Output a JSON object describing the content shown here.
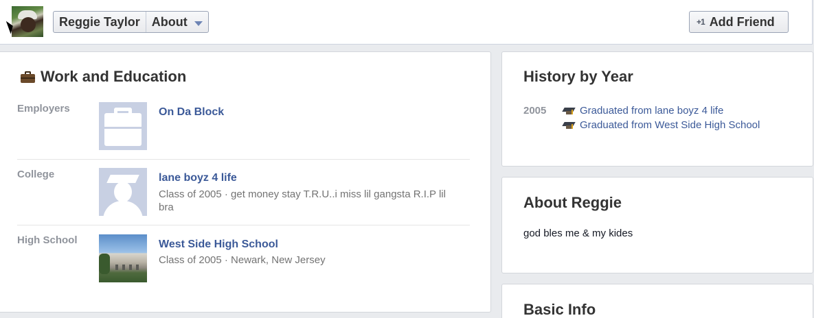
{
  "header": {
    "profile_name": "Reggie Taylor",
    "section": "About",
    "add_friend_label": "Add Friend",
    "add_friend_icon": "+1"
  },
  "work_education": {
    "title": "Work and Education",
    "employers": {
      "label": "Employers",
      "name": "On Da Block"
    },
    "college": {
      "label": "College",
      "name": "lane boyz 4 life",
      "detail": "Class of 2005 · get money stay T.R.U..i miss lil gangsta R.I.P lil bra"
    },
    "high_school": {
      "label": "High School",
      "name": "West Side High School",
      "detail": "Class of 2005 · Newark, New Jersey"
    }
  },
  "history": {
    "title": "History by Year",
    "year": "2005",
    "items": [
      "Graduated from lane boyz 4 life",
      "Graduated from West Side High School"
    ]
  },
  "about": {
    "title": "About Reggie",
    "text": "god bles me & my kides"
  },
  "basic_info": {
    "title": "Basic Info"
  },
  "colors": {
    "link": "#3b5998",
    "muted": "#90949c",
    "background": "#e9ebee"
  }
}
